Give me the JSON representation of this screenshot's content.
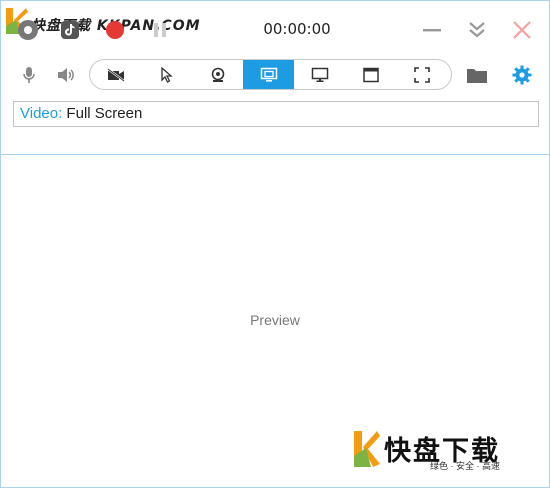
{
  "watermark": {
    "top_text": "快盘下载 KKPAN.COM",
    "bottom_text": "快盘下载",
    "bottom_subtext": "绿色 · 安全 · 高速"
  },
  "titlebar": {
    "timer": "00:00:00",
    "buttons": [
      "settings",
      "tiktok",
      "record",
      "pause",
      "minimize",
      "collapse",
      "close"
    ]
  },
  "toolbar": {
    "icons_left": [
      "microphone-icon",
      "speaker-icon"
    ],
    "modes": [
      {
        "name": "camera-off",
        "active": false
      },
      {
        "name": "cursor",
        "active": false
      },
      {
        "name": "webcam",
        "active": false
      },
      {
        "name": "screen-window",
        "active": true
      },
      {
        "name": "monitor",
        "active": false
      },
      {
        "name": "window",
        "active": false
      },
      {
        "name": "fullscreen",
        "active": false
      }
    ],
    "icons_right": [
      "folder-icon",
      "gear-icon"
    ]
  },
  "info": {
    "key": "Video:",
    "value": " Full Screen"
  },
  "preview": {
    "label": "Preview"
  },
  "colors": {
    "accent": "#1d9ce3",
    "border": "#a9d3ee",
    "record": "#e53935"
  }
}
